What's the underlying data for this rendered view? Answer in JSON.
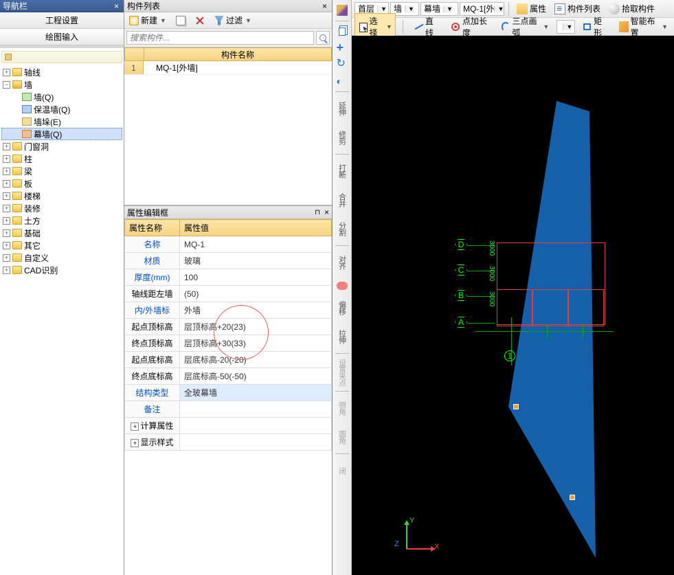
{
  "left_panel": {
    "title": "导航栏",
    "close_x": "×",
    "tab_project": "工程设置",
    "tab_drawing": "绘图输入",
    "nodes": {
      "axis": "轴线",
      "wall": "墙",
      "wall_q": "墙(Q)",
      "wall_ins": "保温墙(Q)",
      "wall_duo": "墙垛(E)",
      "wall_mq": "幕墙(Q)",
      "door": "门窗洞",
      "column": "柱",
      "beam": "梁",
      "slab": "板",
      "stair": "楼梯",
      "deco": "装修",
      "earth": "土方",
      "found": "基础",
      "other": "其它",
      "custom": "自定义",
      "cad": "CAD识别"
    }
  },
  "mid_panel": {
    "list_title": "构件列表",
    "btn_new": "新建",
    "btn_copy": "",
    "btn_del": "",
    "btn_filter": "过滤",
    "search_ph": "搜索构件...",
    "col_name": "构件名称",
    "row1_num": "1",
    "row1_name": "MQ-1[外墙]",
    "prop_title": "属性编辑框",
    "hdr_name": "属性名称",
    "hdr_val": "属性值",
    "rows": [
      {
        "n": "名称",
        "v": "MQ-1",
        "blue": true
      },
      {
        "n": "材质",
        "v": "玻璃",
        "blue": true
      },
      {
        "n": "厚度(mm)",
        "v": "100",
        "blue": true
      },
      {
        "n": "轴线距左墙",
        "v": "(50)",
        "blue": false
      },
      {
        "n": "内/外墙标",
        "v": "外墙",
        "blue": true
      },
      {
        "n": "起点顶标高",
        "v": "层顶标高+20(23)",
        "blue": false
      },
      {
        "n": "终点顶标高",
        "v": "层顶标高+30(33)",
        "blue": false
      },
      {
        "n": "起点底标高",
        "v": "层底标高-20(-20)",
        "blue": false
      },
      {
        "n": "终点底标高",
        "v": "层底标高-50(-50)",
        "blue": false
      },
      {
        "n": "结构类型",
        "v": "全玻幕墙",
        "blue": true,
        "sel": true
      },
      {
        "n": "备注",
        "v": "",
        "blue": true
      }
    ],
    "exp_calc": "计算属性",
    "exp_disp": "显示样式"
  },
  "toolbar_top": {
    "combo_floor": "首层",
    "combo_cat": "墙",
    "combo_sub": "幕墙",
    "combo_comp": "MQ-1[外",
    "btn_prop": "属性",
    "btn_list": "构件列表",
    "btn_pick": "拾取构件"
  },
  "toolbar_draw": {
    "btn_select": "选择",
    "btn_line": "直线",
    "btn_ptlen": "点加长度",
    "btn_arc3": "三点画弧",
    "btn_rect": "矩形",
    "btn_smart": "智能布置"
  },
  "vtool": {
    "extend": "延伸",
    "trim": "修剪",
    "break": "打断",
    "merge": "合并",
    "split": "分割",
    "align": "对齐",
    "offset": "偏移",
    "stretch": "拉伸",
    "setgrip": "设置夹点",
    "chamfer": "倒角",
    "fillet": "圆角",
    "close": "闭"
  },
  "viewport": {
    "grid_labels": [
      "D",
      "C",
      "B",
      "A"
    ],
    "grid_num": "1",
    "dims": [
      "3000",
      "3000",
      "3000"
    ],
    "axis_x": "X",
    "axis_y": "Y",
    "axis_z": "Z"
  }
}
